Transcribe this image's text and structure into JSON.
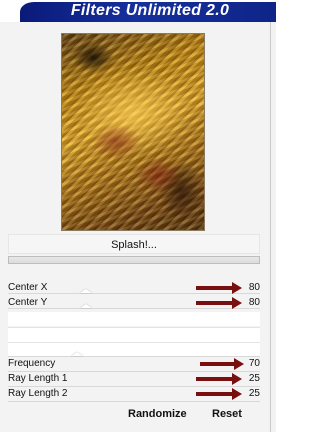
{
  "window": {
    "title": "Filters Unlimited 2.0"
  },
  "preview": {
    "label": "Preview image"
  },
  "splash_button": {
    "label": "Splash!..."
  },
  "params": [
    {
      "label": "Center X",
      "value": "80"
    },
    {
      "label": "Center Y",
      "value": "80"
    },
    {
      "label": "Frequency",
      "value": "70"
    },
    {
      "label": "Ray Length 1",
      "value": "25"
    },
    {
      "label": "Ray Length 2",
      "value": "25"
    }
  ],
  "buttons": {
    "randomize": "Randomize",
    "reset": "Reset"
  },
  "colors": {
    "title_bar": "#16309c",
    "annotation_arrow": "#7a0f0f"
  }
}
